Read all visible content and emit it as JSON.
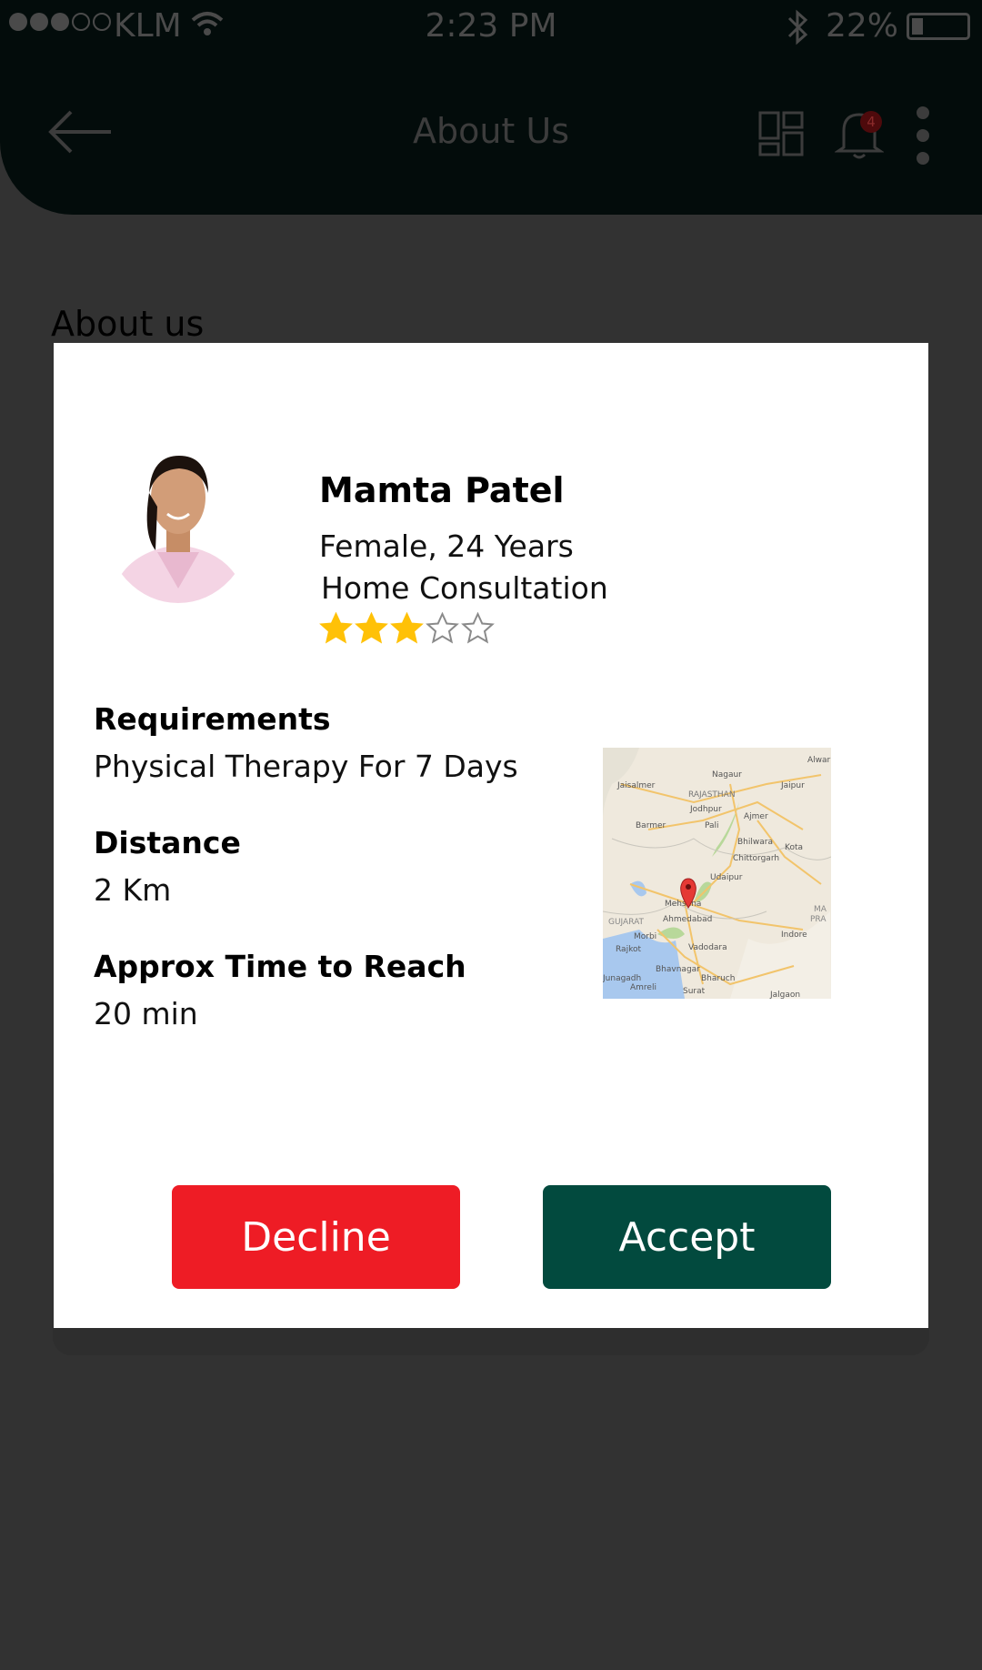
{
  "status_bar": {
    "carrier": "KLM",
    "time": "2:23 PM",
    "battery": "22%",
    "signal_bars_filled": 3,
    "signal_bars_total": 5,
    "battery_level": 0.22
  },
  "header": {
    "title": "About Us",
    "notification_count": "4"
  },
  "background": {
    "heading": "About us"
  },
  "profile": {
    "name": "Mamta Patel",
    "gender_age": "Female, 24 Years",
    "consultation_type": "Home Consultation",
    "rating": 3,
    "rating_max": 5
  },
  "details": {
    "requirements_label": "Requirements",
    "requirements_value": "Physical Therapy For 7 Days",
    "distance_label": "Distance",
    "distance_value": "2 Km",
    "time_label": "Approx Time to Reach",
    "time_value": "20 min"
  },
  "map": {
    "labels": [
      "Nagaur",
      "Alwar",
      "Jaisalmer",
      "Jaipur",
      "RAJASTHAN",
      "Jodhpur",
      "Ajmer",
      "Barmer",
      "Pali",
      "Bhilwara",
      "Kota",
      "Chittorgarh",
      "Udaipur",
      "Mehsana",
      "GUJARAT",
      "Ahmedabad",
      "MA",
      "PRA",
      "Morbi",
      "Indore",
      "Rajkot",
      "Vadodara",
      "Bhavnagar",
      "Junagadh",
      "Amreli",
      "Bharuch",
      "Surat",
      "Jalgaon"
    ]
  },
  "actions": {
    "decline_label": "Decline",
    "accept_label": "Accept"
  },
  "colors": {
    "decline": "#ee1c25",
    "accept": "#024a3e",
    "star_filled": "#ffc107",
    "overlay": "#323232"
  },
  "icons": {
    "back": "arrow-left-icon",
    "grid": "grid-icon",
    "bell": "bell-icon",
    "more": "more-vertical-icon",
    "wifi": "wifi-icon",
    "bluetooth": "bluetooth-icon",
    "map_pin": "map-pin-icon"
  }
}
